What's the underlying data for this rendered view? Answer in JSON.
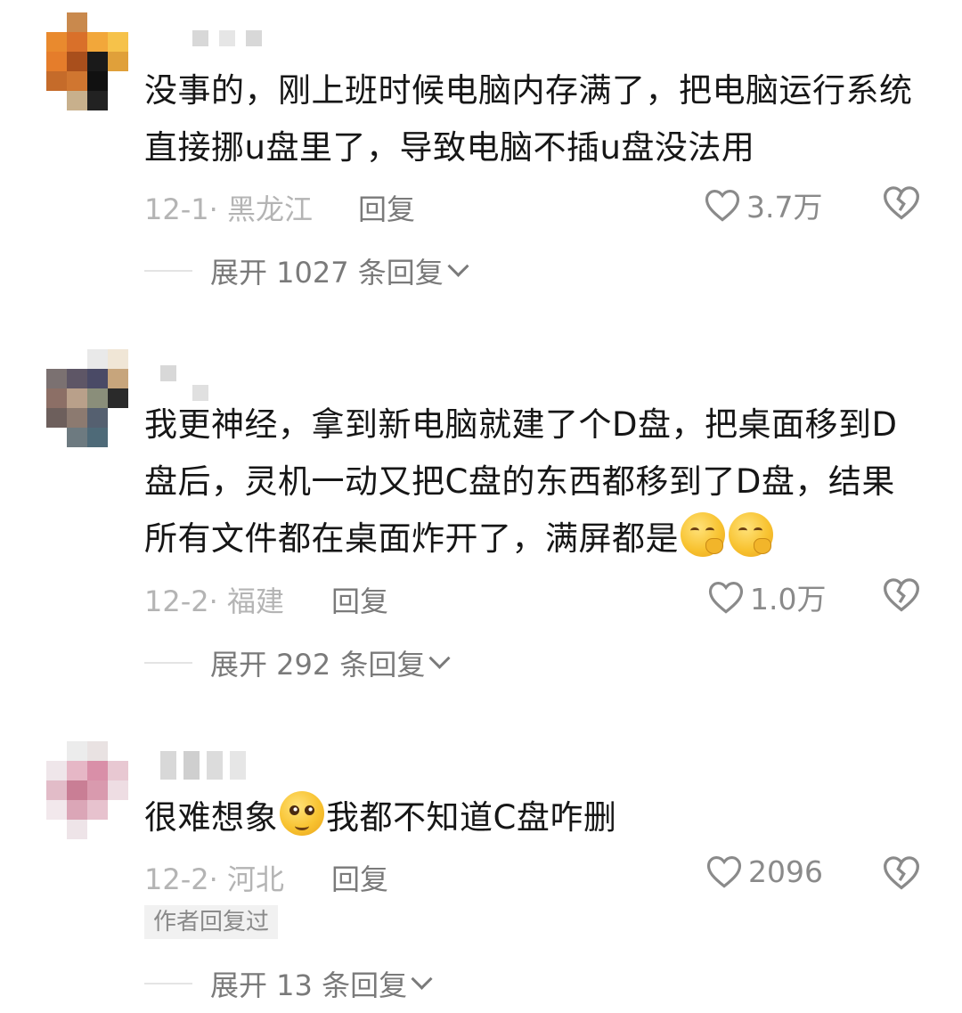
{
  "comments": [
    {
      "text": "没事的，刚上班时候电脑内存满了，把电脑运行系统直接挪u盘里了，导致电脑不插u盘没法用",
      "date": "12-1· 黑龙江",
      "reply_label": "回复",
      "likes": "3.7万",
      "expand_label": "展开 1027 条回复"
    },
    {
      "text": "我更神经，拿到新电脑就建了个D盘，把桌面移到D盘后，灵机一动又把C盘的东西都移到了D盘，结果所有文件都在桌面炸开了，满屏都是",
      "date": "12-2· 福建",
      "reply_label": "回复",
      "likes": "1.0万",
      "expand_label": "展开 292 条回复"
    },
    {
      "text_before_emoji": "很难想象",
      "text_after_emoji": "我都不知道C盘咋删",
      "date": "12-2· 河北",
      "reply_label": "回复",
      "likes": "2096",
      "author_badge": "作者回复过",
      "expand_label": "展开 13 条回复"
    }
  ],
  "icons": {
    "like": "heart-outline-icon",
    "dislike": "broken-heart-icon",
    "emoji_1": "yawning-face-emoji",
    "emoji_2": "pleading-face-emoji"
  },
  "colors": {
    "text": "#161616",
    "meta": "#b4b4b4",
    "secondary": "#7a7a7a",
    "divider": "#e4e4e4"
  }
}
